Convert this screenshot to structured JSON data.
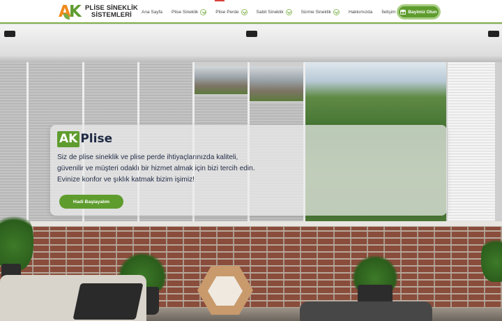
{
  "brand": {
    "logo_letters": "AK",
    "name_line1": "PLİSE SİNEKLİK",
    "name_line2": "SİSTEMLERİ"
  },
  "nav": {
    "items": [
      {
        "label": "Ana Sayfa",
        "has_dropdown": false
      },
      {
        "label": "Plise Sineklik",
        "has_dropdown": true
      },
      {
        "label": "Plise Perde",
        "has_dropdown": true
      },
      {
        "label": "Sabit Sineklik",
        "has_dropdown": true
      },
      {
        "label": "Sürme Sineklik",
        "has_dropdown": true
      },
      {
        "label": "Hakkımızda",
        "has_dropdown": false
      },
      {
        "label": "İletişim",
        "has_dropdown": false
      }
    ],
    "cta_label": "Bayimiz Olun",
    "cta_icon": "gift-icon"
  },
  "hero": {
    "badge": "AK",
    "title": "Plise",
    "description": "Siz de plise sineklik ve plise perde ihtiyaçlarınızda kaliteli, güvenilir ve müşteri odaklı bir hizmet almak için bizi tercih edin. Evinize konfor ve şıklık katmak bizim işimiz!",
    "button_label": "Hadi Başlayalım"
  },
  "colors": {
    "brand_green": "#5f9c2e",
    "brand_orange": "#f08a1c",
    "accent_red": "#d9413b",
    "text_dark": "#1f2a44"
  }
}
